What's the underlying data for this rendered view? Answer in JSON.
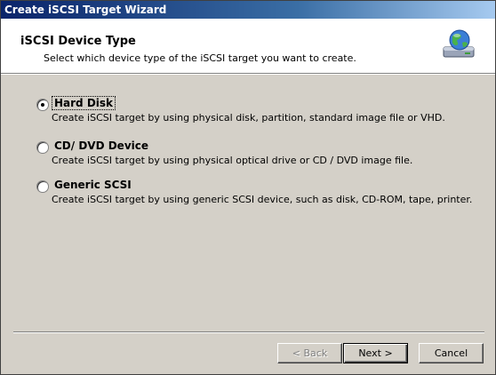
{
  "window": {
    "title": "Create iSCSI Target Wizard"
  },
  "header": {
    "title": "iSCSI Device Type",
    "subtitle": "Select which device type of the iSCSI target you want to create.",
    "icon": "globe-disk-icon"
  },
  "options": [
    {
      "label": "Hard Disk",
      "description": "Create iSCSI target by using physical disk, partition, standard image file or VHD.",
      "selected": true
    },
    {
      "label": "CD/ DVD Device",
      "description": "Create iSCSI target by using physical optical drive or CD / DVD image file.",
      "selected": false
    },
    {
      "label": "Generic SCSI",
      "description": "Create iSCSI target by using generic SCSI device, such as disk, CD-ROM, tape, printer.",
      "selected": false
    }
  ],
  "buttons": {
    "back": "< Back",
    "next": "Next >",
    "cancel": "Cancel"
  },
  "colors": {
    "titlebar_start": "#0a246a",
    "titlebar_end": "#a6caf0",
    "dialog_bg": "#d4d0c8"
  }
}
